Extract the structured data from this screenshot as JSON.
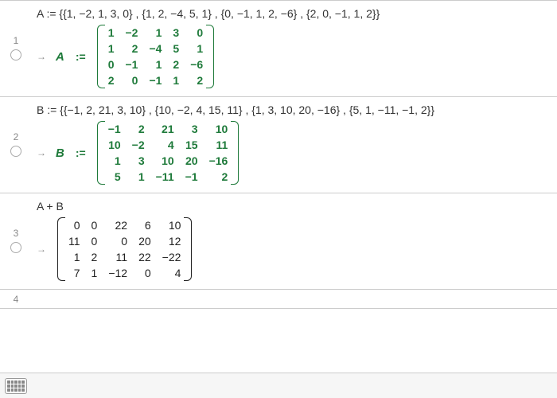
{
  "rows": [
    {
      "index": "1",
      "input": "A := {{1, −2, 1, 3, 0} , {1, 2, −4, 5, 1} , {0, −1, 1, 2, −6} , {2, 0, −1, 1, 2}}",
      "has_radio": true,
      "output": {
        "lhs": "A",
        "assign": ":=",
        "color": "green",
        "matrix": [
          [
            "1",
            "−2",
            "1",
            "3",
            "0"
          ],
          [
            "1",
            "2",
            "−4",
            "5",
            "1"
          ],
          [
            "0",
            "−1",
            "1",
            "2",
            "−6"
          ],
          [
            "2",
            "0",
            "−1",
            "1",
            "2"
          ]
        ]
      }
    },
    {
      "index": "2",
      "input": "B := {{−1, 2, 21, 3, 10} , {10, −2, 4, 15, 11} , {1, 3, 10, 20, −16} , {5, 1, −11, −1, 2}}",
      "has_radio": true,
      "output": {
        "lhs": "B",
        "assign": ":=",
        "color": "green",
        "matrix": [
          [
            "−1",
            "2",
            "21",
            "3",
            "10"
          ],
          [
            "10",
            "−2",
            "4",
            "15",
            "11"
          ],
          [
            "1",
            "3",
            "10",
            "20",
            "−16"
          ],
          [
            "5",
            "1",
            "−11",
            "−1",
            "2"
          ]
        ]
      }
    },
    {
      "index": "3",
      "input": "A + B",
      "has_radio": true,
      "output": {
        "lhs": "",
        "assign": "",
        "color": "black",
        "matrix": [
          [
            "0",
            "0",
            "22",
            "6",
            "10"
          ],
          [
            "11",
            "0",
            "0",
            "20",
            "12"
          ],
          [
            "1",
            "2",
            "11",
            "22",
            "−22"
          ],
          [
            "7",
            "1",
            "−12",
            "0",
            "4"
          ]
        ]
      }
    },
    {
      "index": "4",
      "input": "",
      "has_radio": false,
      "output": null
    }
  ],
  "icons": {
    "keyboard": "keyboard-icon"
  }
}
